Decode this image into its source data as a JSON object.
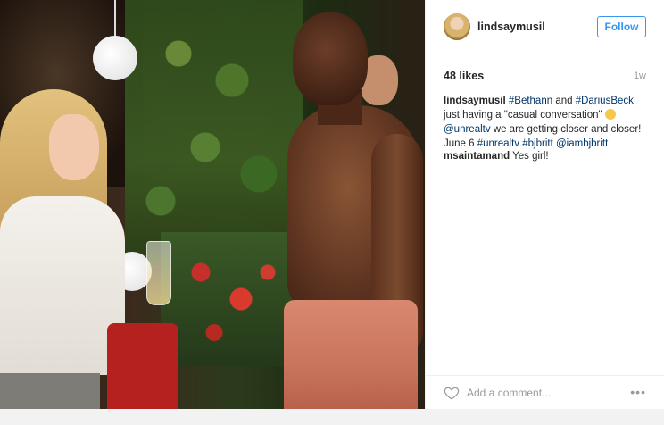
{
  "header": {
    "username": "lindsaymusil",
    "follow_label": "Follow"
  },
  "stats": {
    "likes": "48 likes",
    "time": "1w"
  },
  "caption": {
    "username": "lindsaymusil",
    "tag1": "#Bethann",
    "and": " and ",
    "tag2": "#DariusBeck",
    "text1": " just having a \"casual conversation\" ",
    "mention1": "@unrealtv",
    "text2": " we are getting closer and closer! June 6 ",
    "tag3": "#unrealtv",
    "tag4": "#bjbritt",
    "mention2": "@iambjbritt"
  },
  "comments": [
    {
      "username": "msaintamand",
      "text": "Yes girl!"
    }
  ],
  "footer": {
    "add_comment_placeholder": "Add a comment...",
    "more": "•••"
  },
  "icons": {
    "avatar": "avatar",
    "heart": "heart-icon",
    "more": "more-options-icon",
    "emoji": "flushed-emoji-icon"
  },
  "colors": {
    "link": "#003569",
    "follow": "#3897f0"
  }
}
